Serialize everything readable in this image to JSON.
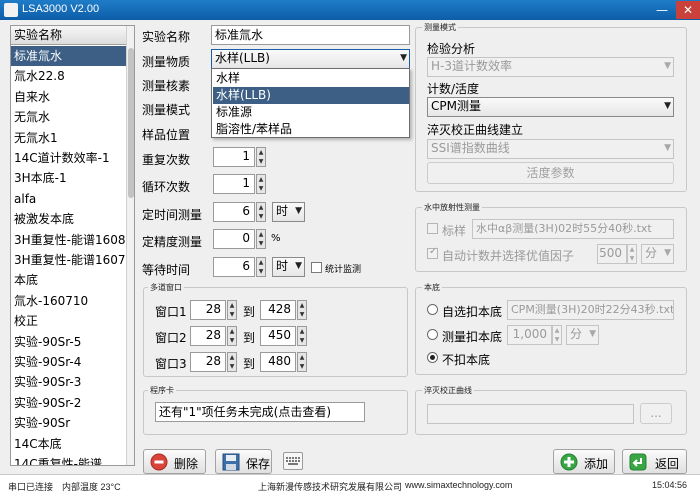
{
  "window": {
    "title": "LSA3000 V2.00",
    "minimize": "—",
    "close": "✕"
  },
  "experiment_list": {
    "header": "实验名称",
    "items": [
      "标准氚水",
      "氚水22.8",
      "自来水",
      "无氚水",
      "无氚水1",
      "14C道计数效率-1",
      "3H本底-1",
      "alfa",
      "被激发本底",
      "3H重复性-能谱1608",
      "3H重复性-能谱1607",
      "本底",
      "氚水-160710",
      "校正",
      "实验-90Sr-5",
      "实验-90Sr-4",
      "实验-90Sr-3",
      "实验-90Sr-2",
      "实验-90Sr",
      "14C本底",
      "14C重复性-能谱"
    ],
    "selected_index": 0
  },
  "form": {
    "name_label": "实验名称",
    "name_value": "标准氚水",
    "substance_label": "测量物质",
    "substance_value": "水样(LLB)",
    "substance_options": [
      "水样",
      "水样(LLB)",
      "标准源",
      "脂溶性/苯样品"
    ],
    "substance_selected_index": 1,
    "nuclide_label": "测量核素",
    "mode_label": "测量模式",
    "position_label": "样品位置",
    "repeat_label": "重复次数",
    "repeat_value": "1",
    "cycle_label": "循环次数",
    "cycle_value": "1",
    "timed_label": "定时间测量",
    "timed_value": "6",
    "timed_unit": "时",
    "precision_label": "定精度测量",
    "precision_value": "0",
    "precision_unit": "%",
    "wait_label": "等待时间",
    "wait_value": "6",
    "wait_unit": "时",
    "monitor_label": "统计监测"
  },
  "multichannel": {
    "title": "多道窗口",
    "to_label": "到",
    "rows": [
      {
        "label": "窗口1",
        "from": "28",
        "to": "428"
      },
      {
        "label": "窗口2",
        "from": "28",
        "to": "450"
      },
      {
        "label": "窗口3",
        "from": "28",
        "to": "480"
      }
    ]
  },
  "program": {
    "title": "程序卡",
    "message": "还有\"1\"项任务未完成(点击查看)"
  },
  "measure_mode": {
    "title": "测量模式",
    "analysis_label": "检验分析",
    "analysis_value": "H-3道计数效率",
    "count_label": "计数/活度",
    "count_value": "CPM测量",
    "quench_label": "淬灭校正曲线建立",
    "quench_value": "SSI谱指数曲线",
    "activity_button": "活度参数"
  },
  "water": {
    "title": "水中放射性测量",
    "standard_label": "标样",
    "standard_value": "水中αβ测量(3H)02时55分40秒.txt",
    "auto_label": "自动计数并选择优值因子",
    "auto_value": "500",
    "auto_unit": "分"
  },
  "background": {
    "title": "本底",
    "auto_label": "自选扣本底",
    "auto_value": "CPM测量(3H)20时22分43秒.txt",
    "measure_label": "测量扣本底",
    "measure_value": "1,000",
    "measure_unit": "分",
    "none_label": "不扣本底"
  },
  "quench_curve": {
    "title": "淬灭校正曲线",
    "browse": "..."
  },
  "buttons": {
    "delete": "删除",
    "save": "保存",
    "add": "添加",
    "back": "返回"
  },
  "status": {
    "serial": "串口已连接",
    "temp": "内部温度 23°C",
    "company": "上海新漫传感技术研究发展有限公司",
    "website": "www.simaxtechnology.com",
    "time": "15:04:56"
  },
  "colors": {
    "titlebar": "#1473c2",
    "selection": "#3d5f85",
    "add_icon": "#3aa545",
    "delete_icon": "#d9443a"
  }
}
